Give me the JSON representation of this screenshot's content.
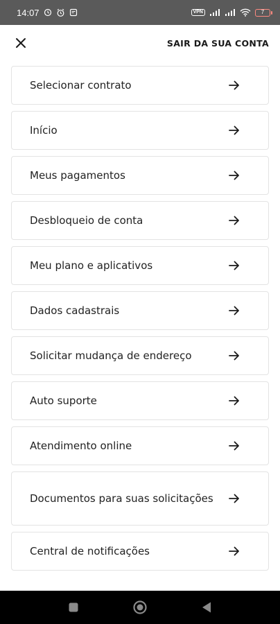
{
  "status_bar": {
    "time": "14:07",
    "vpn": "VPN",
    "battery_level": "7",
    "icons": [
      "alarm-icon",
      "clock-icon",
      "notification-icon",
      "vpn-icon",
      "signal-icon",
      "signal-icon",
      "wifi-icon",
      "battery-icon"
    ]
  },
  "header": {
    "close_icon": "close-icon",
    "logout_label": "SAIR DA SUA CONTA"
  },
  "menu": {
    "items": [
      {
        "label": "Selecionar contrato"
      },
      {
        "label": "Início"
      },
      {
        "label": "Meus pagamentos"
      },
      {
        "label": "Desbloqueio de conta"
      },
      {
        "label": "Meu plano e aplicativos"
      },
      {
        "label": "Dados cadastrais"
      },
      {
        "label": "Solicitar mudança de endereço"
      },
      {
        "label": "Auto suporte"
      },
      {
        "label": "Atendimento online"
      },
      {
        "label": "Documentos para suas solicitações"
      },
      {
        "label": "Central de notificações"
      }
    ],
    "arrow_icon": "arrow-right-icon"
  },
  "nav_bar": {
    "buttons": [
      "recents-square-icon",
      "home-circle-icon",
      "back-triangle-icon"
    ]
  },
  "colors": {
    "status_bar_bg": "#5a5a5a",
    "card_border": "#e3e3e3",
    "text": "#1a1a1a",
    "nav_bar_bg": "#000000",
    "battery_low": "#ff8a80"
  }
}
